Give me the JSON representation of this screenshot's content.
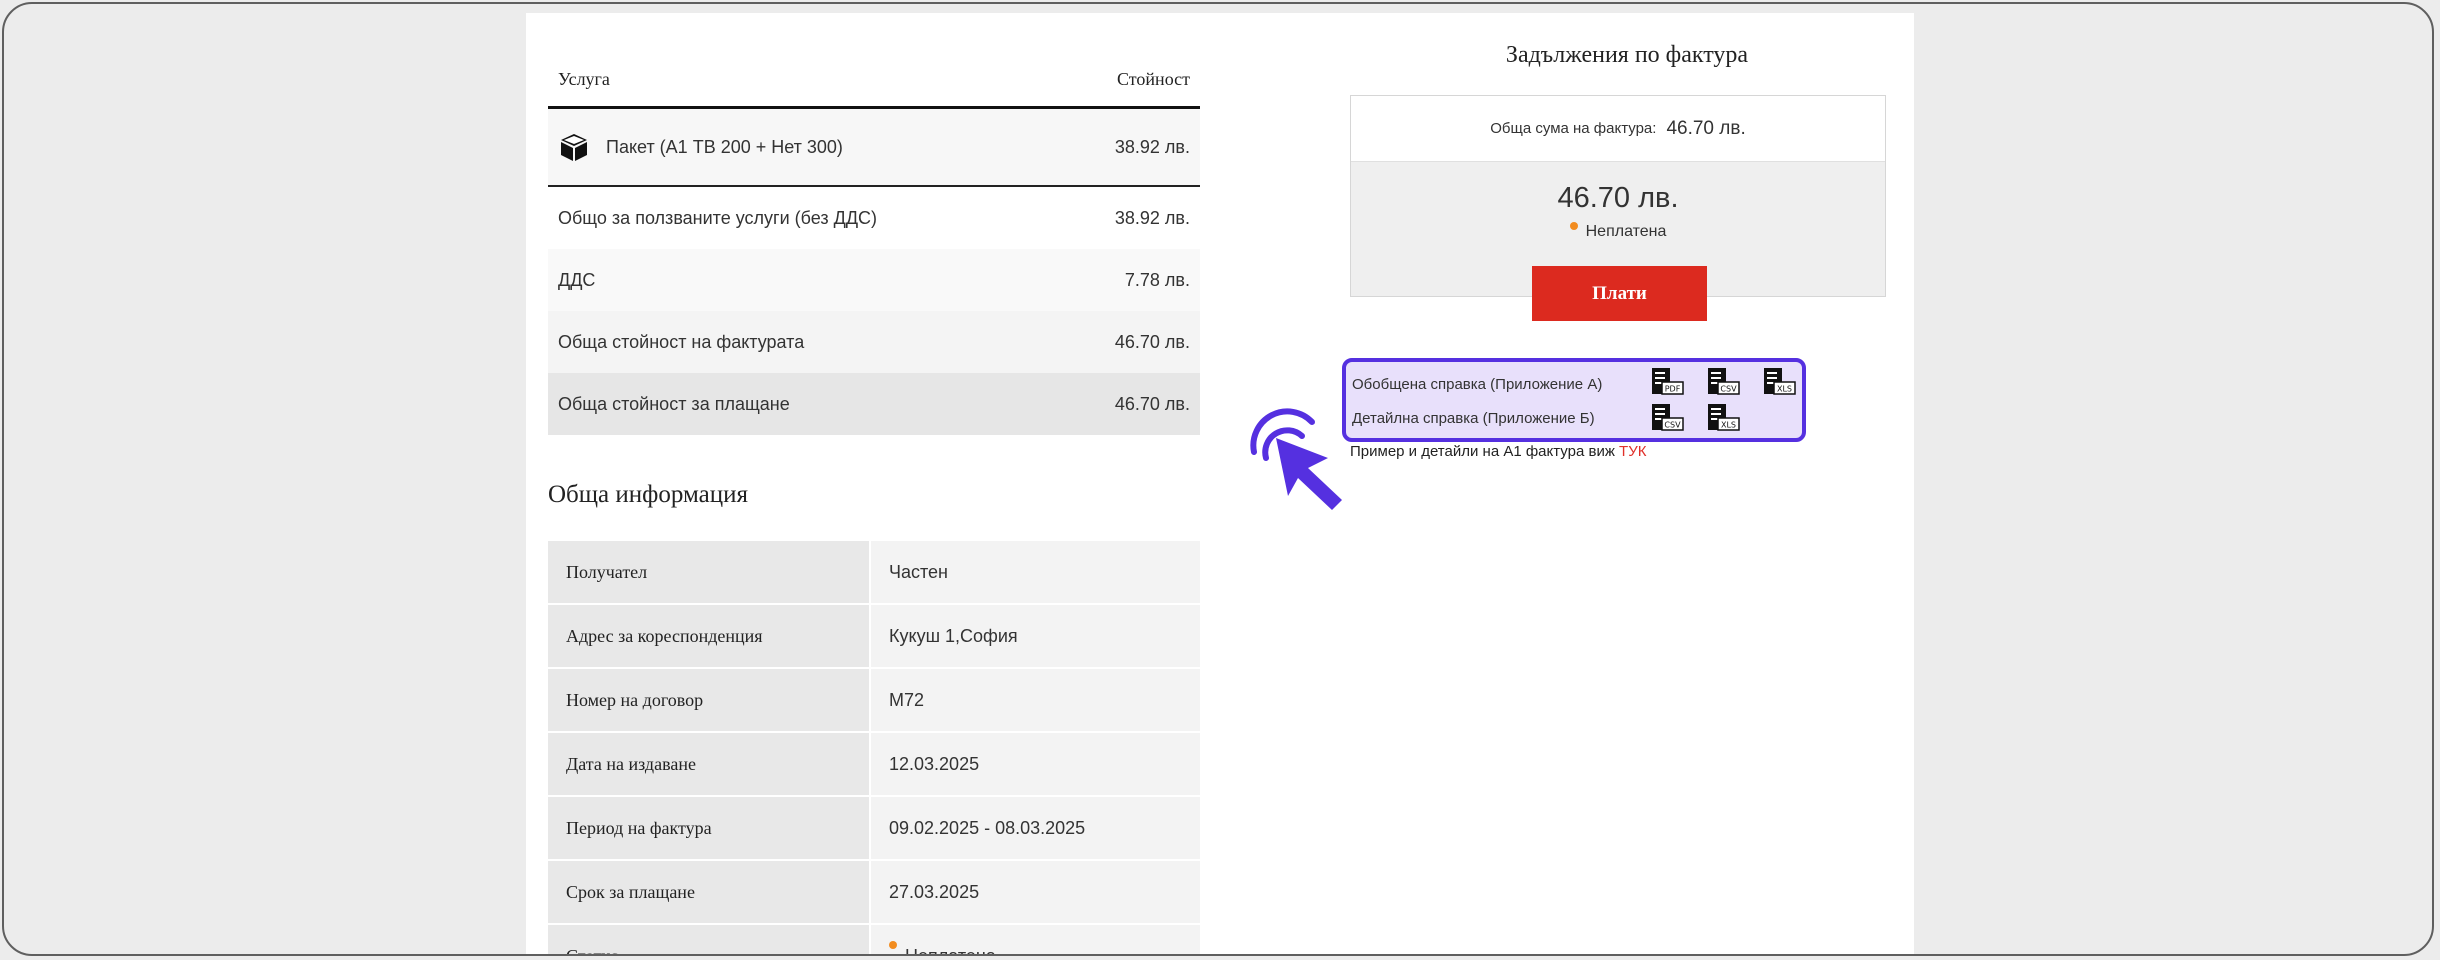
{
  "services": {
    "header_service": "Услуга",
    "header_value": "Стойност",
    "package": {
      "label": "Пакет (А1 ТВ 200 + Нет 300)",
      "value": "38.92 лв.",
      "icon": "box-icon"
    },
    "rows": [
      {
        "label": "Общо за ползваните услуги (без ДДС)",
        "value": "38.92 лв."
      },
      {
        "label": "ДДС",
        "value": "7.78 лв."
      },
      {
        "label": "Обща стойност на фактурата",
        "value": "46.70 лв."
      },
      {
        "label": "Обща стойност за плащане",
        "value": "46.70 лв."
      }
    ]
  },
  "general": {
    "title": "Обща информация",
    "rows": [
      {
        "label": "Получател",
        "value": "Частен"
      },
      {
        "label": "Адрес за кореспонденция",
        "value": "Кукуш 1,София"
      },
      {
        "label": "Номер на договор",
        "value": "M72"
      },
      {
        "label": "Дата на издаване",
        "value": "12.03.2025"
      },
      {
        "label": "Период на фактура",
        "value": "09.02.2025 - 08.03.2025"
      },
      {
        "label": "Срок за плащане",
        "value": "27.03.2025"
      },
      {
        "label": "Статус",
        "value": "Неплатена"
      }
    ]
  },
  "invoice": {
    "title": "Задължения по фактура",
    "total_label": "Обща сума на фактура:",
    "total_value": "46.70 лв.",
    "big_amount": "46.70 лв.",
    "status": "Неплатена",
    "status_color": "#f28c1f",
    "pay_button": "Плати",
    "pay_color": "#dc2a1f"
  },
  "reports": {
    "summary_label": "Обобщена справка (Приложение А)",
    "summary_files": [
      "PDF",
      "CSV",
      "XLS"
    ],
    "detailed_label": "Детайлна справка (Приложение Б)",
    "detailed_files": [
      "CSV",
      "XLS"
    ],
    "note_text": "Пример и детайли на А1 фактура виж",
    "note_link": "ТУК",
    "highlight_color": "#5530e0"
  }
}
